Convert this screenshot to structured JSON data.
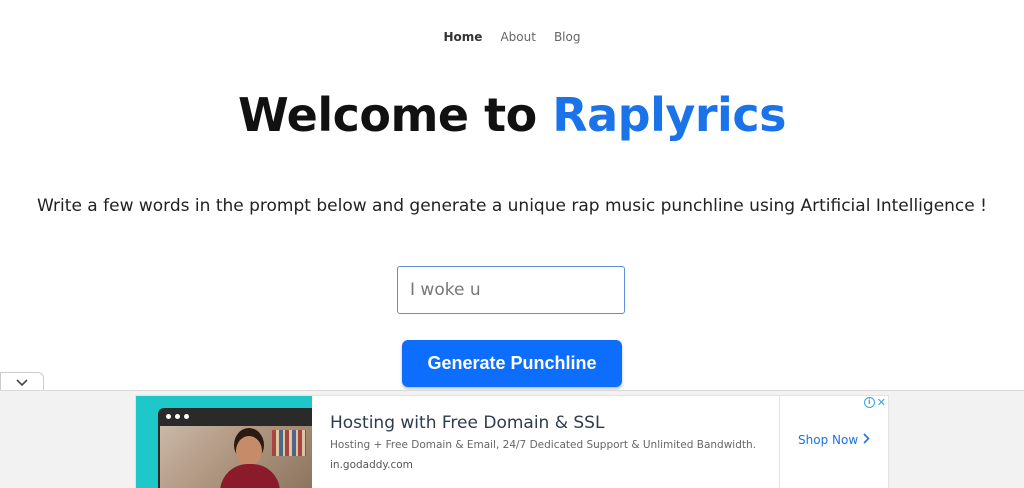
{
  "nav": {
    "items": [
      {
        "label": "Home",
        "active": true
      },
      {
        "label": "About",
        "active": false
      },
      {
        "label": "Blog",
        "active": false
      }
    ]
  },
  "hero": {
    "prefix": "Welcome to ",
    "brand": "Raplyrics",
    "brand_color": "#1a73e8"
  },
  "subtitle": "Write a few words in the prompt below and generate a unique rap music punchline using Artificial Intelligence !",
  "prompt": {
    "value": "I woke u"
  },
  "generate_button": {
    "label": "Generate Punchline",
    "color": "#0d6efd"
  },
  "collapse_tab": {
    "icon": "chevron-down-icon"
  },
  "ad": {
    "title": "Hosting with Free Domain & SSL",
    "description": "Hosting + Free Domain & Email, 24/7 Dedicated Support & Unlimited Bandwidth.",
    "domain": "in.godaddy.com",
    "cta": "Shop Now",
    "cta_icon": "chevron-right-icon",
    "info_icon": "adchoices-info-icon",
    "close_icon": "close-icon",
    "accent": "#1ec8c8"
  }
}
